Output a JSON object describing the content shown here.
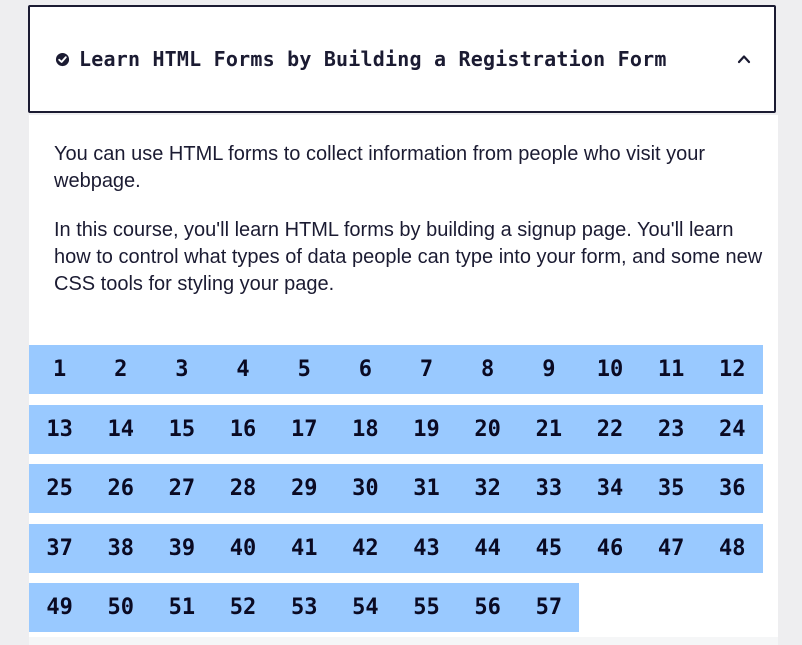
{
  "block": {
    "title": "Learn HTML Forms by Building a Registration Form",
    "icons": {
      "status": "check-circle-icon",
      "toggle": "chevron-up-icon"
    }
  },
  "description": [
    "You can use HTML forms to collect information from people who visit your webpage.",
    "In this course, you'll learn HTML forms by building a signup page. You'll learn how to control what types of data people can type into your form, and some new CSS tools for styling your page."
  ],
  "steps": {
    "rows": [
      [
        "1",
        "2",
        "3",
        "4",
        "5",
        "6",
        "7",
        "8",
        "9",
        "10",
        "11",
        "12"
      ],
      [
        "13",
        "14",
        "15",
        "16",
        "17",
        "18",
        "19",
        "20",
        "21",
        "22",
        "23",
        "24"
      ],
      [
        "25",
        "26",
        "27",
        "28",
        "29",
        "30",
        "31",
        "32",
        "33",
        "34",
        "35",
        "36"
      ],
      [
        "37",
        "38",
        "39",
        "40",
        "41",
        "42",
        "43",
        "44",
        "45",
        "46",
        "47",
        "48"
      ],
      [
        "49",
        "50",
        "51",
        "52",
        "53",
        "54",
        "55",
        "56",
        "57"
      ]
    ]
  },
  "colors": {
    "step_bg": "#99c9ff",
    "text": "#1b1b32"
  }
}
